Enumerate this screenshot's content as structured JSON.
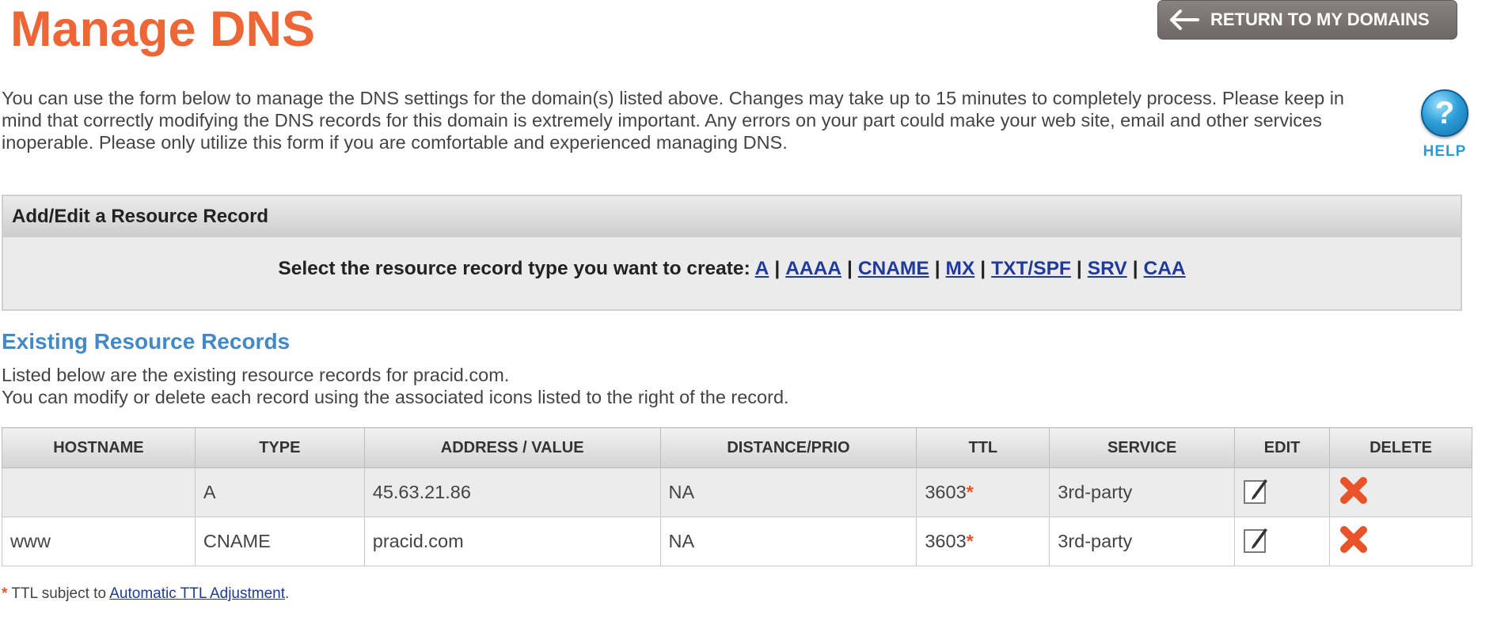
{
  "page": {
    "title": "Manage DNS",
    "return_button_label": "RETURN TO MY DOMAINS",
    "intro": "You can use the form below to manage the DNS settings for the domain(s) listed above. Changes may take up to 15 minutes to completely process. Please keep in mind that correctly modifying the DNS records for this domain is extremely important. Any errors on your part could make your web site, email and other services inoperable. Please only utilize this form if you are comfortable and experienced managing DNS.",
    "help_label": "HELP",
    "help_glyph": "?"
  },
  "add_edit": {
    "header": "Add/Edit a Resource Record",
    "prompt": "Select the resource record type you want to create:",
    "types": [
      "A",
      "AAAA",
      "CNAME",
      "MX",
      "TXT/SPF",
      "SRV",
      "CAA"
    ],
    "separator": "|"
  },
  "existing": {
    "title": "Existing Resource Records",
    "line1": "Listed below are the existing resource records for pracid.com.",
    "line2": "You can modify or delete each record using the associated icons listed to the right of the record."
  },
  "table": {
    "headers": {
      "hostname": "HOSTNAME",
      "type": "TYPE",
      "address": "ADDRESS / VALUE",
      "distance": "DISTANCE/PRIO",
      "ttl": "TTL",
      "service": "SERVICE",
      "edit": "EDIT",
      "delete": "DELETE"
    },
    "ttl_marker": "*",
    "rows": [
      {
        "hostname": "",
        "type": "A",
        "address": "45.63.21.86",
        "distance": "NA",
        "ttl": "3603",
        "service": "3rd-party"
      },
      {
        "hostname": "www",
        "type": "CNAME",
        "address": "pracid.com",
        "distance": "NA",
        "ttl": "3603",
        "service": "3rd-party"
      }
    ]
  },
  "footnote": {
    "marker": "*",
    "text_before": " TTL subject to ",
    "link": "Automatic TTL Adjustment",
    "text_after": "."
  },
  "colors": {
    "title": "#ee6536",
    "section_title": "#4189c7",
    "link": "#1f3a9a",
    "asterisk": "#e8532a",
    "delete_icon": "#e8532a"
  },
  "icons": {
    "return": "arrow-left-icon",
    "help": "help-icon",
    "edit": "edit-icon",
    "delete": "delete-icon"
  }
}
